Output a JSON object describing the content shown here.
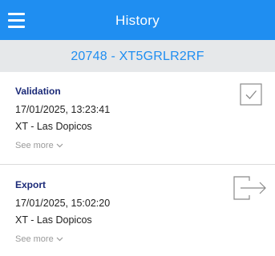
{
  "header": {
    "title": "History",
    "menu_icon": "hamburger-menu-icon",
    "color": "#1f8ef1"
  },
  "subheader": {
    "title": "20748 - XT5GRLR2RF",
    "background": "#e6e8ea"
  },
  "entries": [
    {
      "type": "Validation",
      "datetime": "17/01/2025, 13:23:41",
      "location": "XT - Las Dopicos",
      "see_more": "See more",
      "icon": "checkbox-checked-icon"
    },
    {
      "type": "Export",
      "datetime": "17/01/2025, 15:02:20",
      "location": "XT - Las Dopicos",
      "see_more": "See more",
      "icon": "export-icon"
    }
  ]
}
